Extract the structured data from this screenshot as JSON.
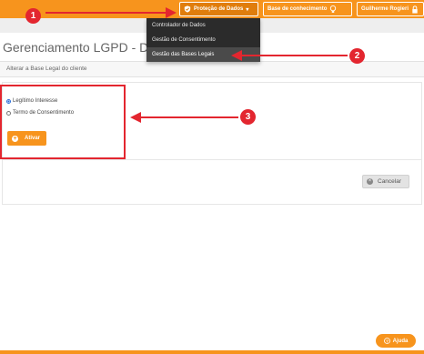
{
  "topbar": {
    "nav": [
      {
        "label": "Proteção de Dados",
        "icon": "shield-icon",
        "has_caret": true
      },
      {
        "label": "Base de conhecimento",
        "icon": "lightbulb-icon"
      },
      {
        "label": "Guilherme Rogieri",
        "icon": "lock-icon"
      }
    ]
  },
  "dropdown": {
    "items": [
      {
        "label": "Controlador de Dados"
      },
      {
        "label": "Gestão de Consentimento"
      },
      {
        "label": "Gestão das Bases Legais"
      }
    ]
  },
  "page": {
    "title": "Gerenciamento LGPD - Defini",
    "section_label": "Alterar a Base Legal do cliente"
  },
  "form": {
    "options": [
      {
        "label": "Legítimo Interesse",
        "checked": true
      },
      {
        "label": "Termo de Consentimento",
        "checked": false
      }
    ],
    "activate_label": "Ativar",
    "cancel_label": "Cancelar"
  },
  "help": {
    "label": "Ajuda"
  },
  "annotations": {
    "badges": [
      "1",
      "2",
      "3"
    ],
    "color": "#e3262f"
  },
  "colors": {
    "accent": "#f7941d",
    "menu_bg": "#2b2b2b"
  }
}
